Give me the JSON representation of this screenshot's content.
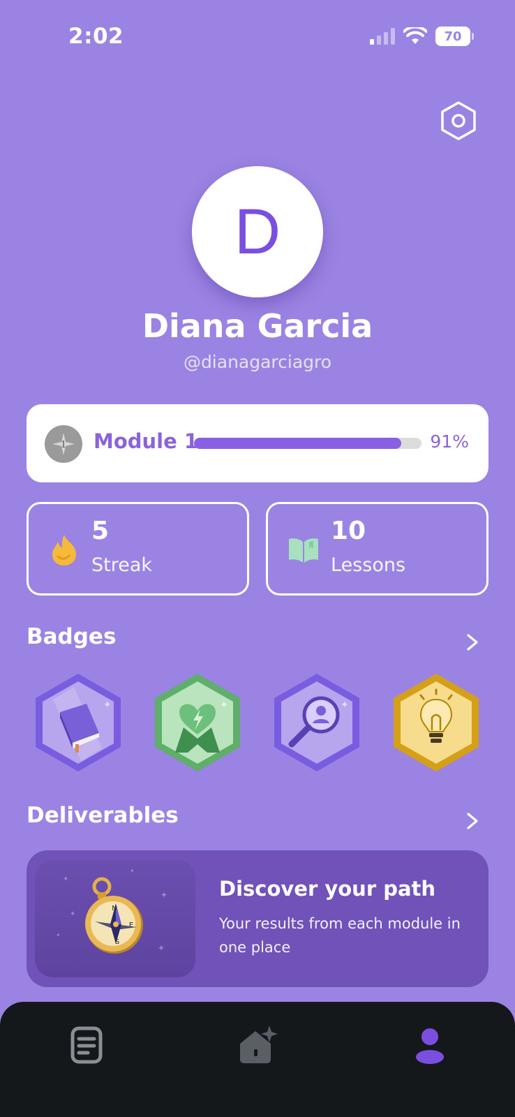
{
  "status_bar": {
    "time": "2:02",
    "battery": "70",
    "icons": [
      "signal-icon",
      "wifi-icon",
      "battery-icon"
    ]
  },
  "header": {
    "settings_icon": "settings-hexagon-icon"
  },
  "profile": {
    "avatar_initial": "D",
    "name": "Diana Garcia",
    "handle": "@dianagarciagro"
  },
  "module": {
    "icon_number": "1",
    "label": "Module 1",
    "progress": 0.91,
    "percent_text": "91%"
  },
  "stats": {
    "streak": {
      "value": "5",
      "label": "Streak",
      "icon": "flame-icon"
    },
    "lessons": {
      "value": "10",
      "label": "Lessons",
      "icon": "open-book-icon"
    }
  },
  "badges": {
    "title": "Badges",
    "items": [
      {
        "name": "book-badge",
        "color": "#7a5ce0"
      },
      {
        "name": "heart-lightning-badge",
        "color": "#5fae6a"
      },
      {
        "name": "search-person-badge",
        "color": "#7a5ce0"
      },
      {
        "name": "lightbulb-badge",
        "color": "#d4a017"
      }
    ]
  },
  "deliverables": {
    "title": "Deliverables",
    "card": {
      "title": "Discover your path",
      "description": "Your results from each module in one place",
      "image": "compass-icon"
    }
  },
  "bottom_nav": {
    "items": [
      {
        "name": "lessons-tab",
        "icon": "document-icon",
        "active": false
      },
      {
        "name": "home-tab",
        "icon": "home-sparkle-icon",
        "active": false
      },
      {
        "name": "profile-tab",
        "icon": "profile-icon",
        "active": true
      }
    ]
  },
  "colors": {
    "background": "#9b83e3",
    "accent": "#8a5fe3",
    "card_dark": "#7152b8",
    "nav_bg": "#15181b",
    "streak": "#f6b93b",
    "lessons_icon": "#a8e0c0"
  }
}
